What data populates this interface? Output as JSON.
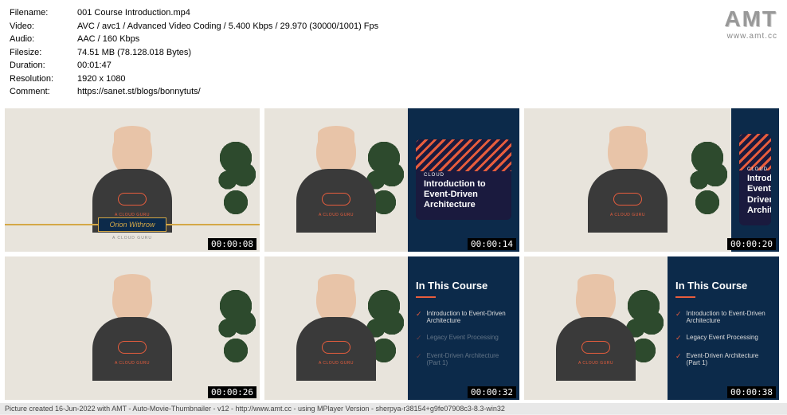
{
  "metadata": {
    "filename_label": "Filename:",
    "filename": "001 Course Introduction.mp4",
    "video_label": "Video:",
    "video": "AVC / avc1 / Advanced Video Coding / 5.400 Kbps / 29.970 (30000/1001) Fps",
    "audio_label": "Audio:",
    "audio": "AAC / 160 Kbps",
    "filesize_label": "Filesize:",
    "filesize": "74.51 MB (78.128.018 Bytes)",
    "duration_label": "Duration:",
    "duration": "00:01:47",
    "resolution_label": "Resolution:",
    "resolution": "1920 x 1080",
    "comment_label": "Comment:",
    "comment": "https://sanet.st/blogs/bonnytuts/"
  },
  "logo": {
    "text": "AMT",
    "url": "www.amt.cc"
  },
  "presenter": {
    "name": "Orion Withrow",
    "org": "A CLOUD GURU",
    "shirt_text": "A CLOUD GURU"
  },
  "slide": {
    "label": "CLOUD",
    "title": "Introduction to Event-Driven Architecture",
    "title_partial": "Introduction Event-Driven Architectu"
  },
  "course": {
    "heading": "In This Course",
    "items": [
      {
        "text": "Introduction to Event-Driven Architecture"
      },
      {
        "text": "Legacy Event Processing"
      },
      {
        "text": "Event-Driven Architecture (Part 1)"
      }
    ]
  },
  "timestamps": [
    "00:00:08",
    "00:00:14",
    "00:00:20",
    "00:00:26",
    "00:00:32",
    "00:00:38"
  ],
  "footer": "Picture created 16-Jun-2022 with AMT - Auto-Movie-Thumbnailer - v12 - http://www.amt.cc - using MPlayer Version - sherpya-r38154+g9fe07908c3-8.3-win32"
}
